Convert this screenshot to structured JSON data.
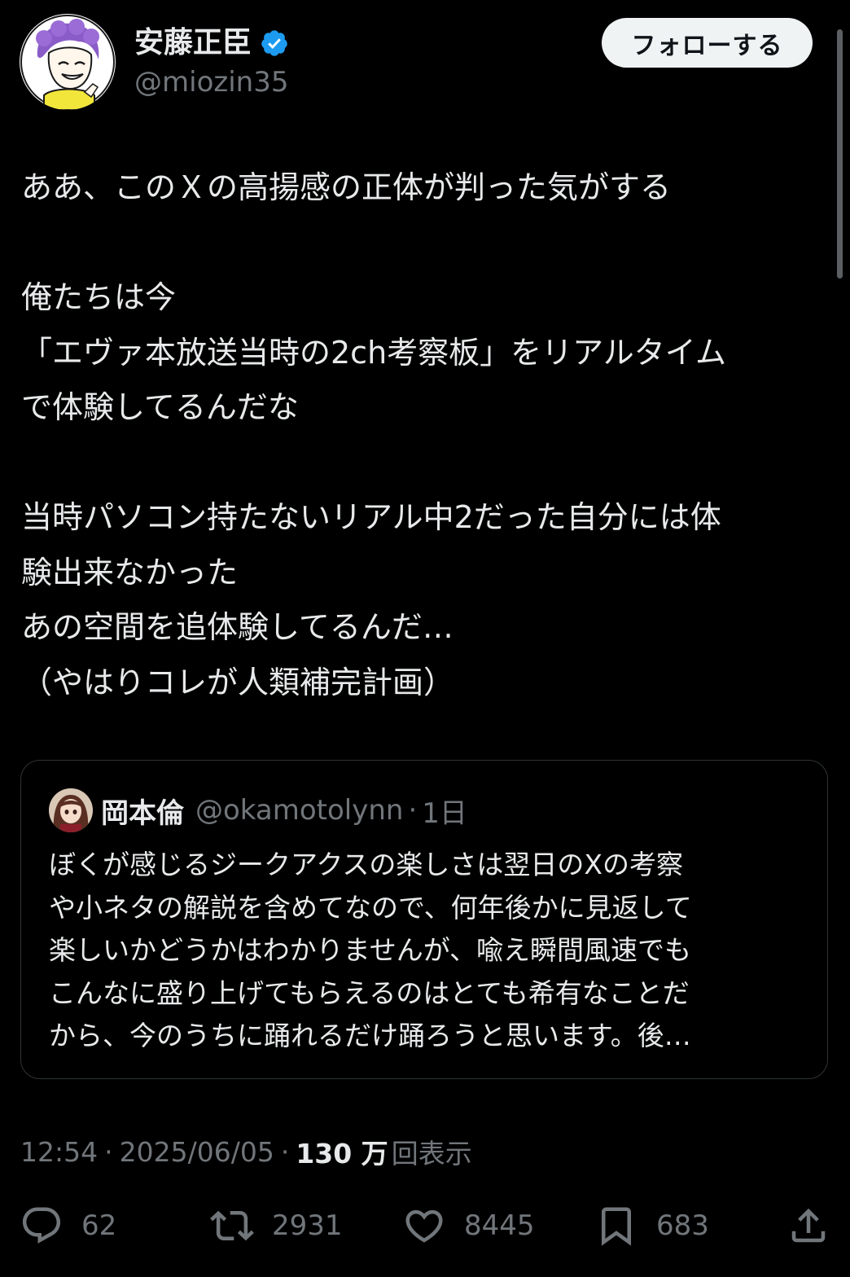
{
  "header": {
    "display_name": "安藤正臣",
    "handle": "@miozin35",
    "follow_label": "フォローする"
  },
  "tweet": {
    "lines": [
      "ああ、このＸの高揚感の正体が判った気がする",
      "",
      "俺たちは今",
      "「エヴァ本放送当時の2ch考察板」をリアルタイム",
      "で体験してるんだな",
      "",
      "当時パソコン持たないリアル中2だった自分には体",
      "験出来なかった",
      "あの空間を追体験してるんだ…",
      "（やはりコレが人類補完計画）"
    ]
  },
  "quote": {
    "name": "岡本倫",
    "handle": "@okamotolynn",
    "dot": "·",
    "time": "1日",
    "lines": [
      "ぼくが感じるジークアクスの楽しさは翌日のXの考察",
      "や小ネタの解説を含めてなので、何年後かに見返して",
      "楽しいかどうかはわかりませんが、喩え瞬間風速でも",
      "こんなに盛り上げてもらえるのはとても希有なことだ",
      "から、今のうちに踊れるだけ踊ろうと思います。後…"
    ]
  },
  "meta": {
    "time": "12:54",
    "sep": "·",
    "date": "2025/06/05",
    "views_count": "130 万",
    "views_label": "回表示"
  },
  "actions": {
    "reply_count": "62",
    "retweet_count": "2931",
    "like_count": "8445",
    "bookmark_count": "683"
  },
  "colors": {
    "background": "#000000",
    "text_primary": "#e7e9ea",
    "text_secondary": "#71767b",
    "verified": "#1d9bf0",
    "border": "#2f3336"
  }
}
